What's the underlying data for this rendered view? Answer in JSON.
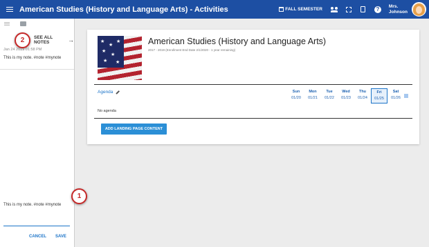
{
  "appbar": {
    "title": "American Studies (History and Language Arts) - Activities",
    "semester": "FALL SEMESTER",
    "user_line1": "Mrs.",
    "user_line2": "Johnson"
  },
  "notes": {
    "see_all": "SEE ALL NOTES",
    "date": "Jan 24 2019 01:58 PM",
    "text": "This is my note. #note #mynote",
    "draft": "This is my note. #note #mynote",
    "cancel": "CANCEL",
    "save": "SAVE"
  },
  "callouts": [
    "1",
    "2"
  ],
  "course": {
    "title": "American Studies (History and Language Arts)",
    "subtitle": "2017 - 2019 (Enrollment End Date 2/1/2020 - 1 year remaining)"
  },
  "agenda": {
    "label": "Agenda",
    "empty": "No agenda",
    "days": [
      {
        "name": "Sun",
        "date": "01/20"
      },
      {
        "name": "Mon",
        "date": "01/21"
      },
      {
        "name": "Tue",
        "date": "01/22"
      },
      {
        "name": "Wed",
        "date": "01/23"
      },
      {
        "name": "Thu",
        "date": "01/24"
      },
      {
        "name": "Fri",
        "date": "01/25"
      },
      {
        "name": "Sat",
        "date": "01/26"
      }
    ],
    "selected_day": "Fri"
  },
  "actions": {
    "add_landing": "ADD LANDING PAGE CONTENT"
  },
  "colors": {
    "appbar": "#1d4fa3",
    "accent": "#1a73c8",
    "callout": "#c62828"
  }
}
